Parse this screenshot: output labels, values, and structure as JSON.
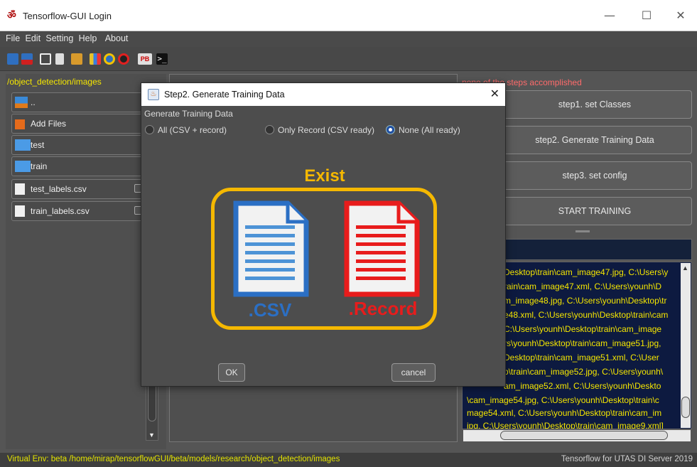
{
  "window": {
    "title": "Tensorflow-GUI Login",
    "minimize": "—",
    "maximize": "☐",
    "close": "✕"
  },
  "menu": [
    "File",
    "Edit",
    "Setting",
    "Help",
    "About"
  ],
  "toolbar": {
    "pb_label": "PB",
    "icons": [
      "new-icon",
      "open-icon",
      "check-icon",
      "delete-icon",
      "import-icon",
      "chart-icon",
      "zoom-icon",
      "zoom-stop-icon",
      "pb-icon",
      "terminal-icon"
    ]
  },
  "left": {
    "path": "/object_detection/images",
    "items": [
      {
        "label": ".."
      },
      {
        "label": "Add Files"
      },
      {
        "label": "test"
      },
      {
        "label": "train"
      },
      {
        "label": "test_labels.csv"
      },
      {
        "label": "train_labels.csv"
      }
    ]
  },
  "right": {
    "status_note": "none of the steps accomplished",
    "steps": [
      "step1. set Classes",
      "step2. Generate Training Data",
      "step3. set config",
      "START TRAINING"
    ],
    "log_lines": [
      "Desktop\\train\\cam_image47.jpg, C:\\Users\\y",
      "rain\\cam_image47.xml, C:\\Users\\younh\\D",
      "m_image48.jpg, C:\\Users\\younh\\Desktop\\tr",
      "e48.xml, C:\\Users\\younh\\Desktop\\train\\cam",
      "C:\\Users\\younh\\Desktop\\train\\cam_image",
      "rs\\younh\\Desktop\\train\\cam_image51.jpg,",
      "Desktop\\train\\cam_image51.xml, C:\\User",
      "p\\train\\cam_image52.jpg, C:\\Users\\younh\\",
      "am_image52.xml, C:\\Users\\younh\\Deskto",
      "\\cam_image54.jpg, C:\\Users\\younh\\Desktop\\train\\c",
      "mage54.xml, C:\\Users\\younh\\Desktop\\train\\cam_im",
      "jpg, C:\\Users\\younh\\Desktop\\train\\cam_image9.xml]"
    ]
  },
  "statusbar": {
    "left": "Virtual Env: beta /home/mirap/tensorflowGUI/beta/models/research/object_detection/images",
    "right": "Tensorflow for UTAS DI Server 2019"
  },
  "dialog": {
    "title": "Step2. Generate Training Data",
    "group_label": "Generate Training Data",
    "options": [
      {
        "label": "All (CSV + record)",
        "selected": false
      },
      {
        "label": "Only Record (CSV ready)",
        "selected": false
      },
      {
        "label": "None (All ready)",
        "selected": true
      }
    ],
    "illustration": {
      "heading": "Exist",
      "csv_label": ".CSV",
      "record_label": ".Record"
    },
    "ok": "OK",
    "cancel": "cancel"
  },
  "colors": {
    "accent_yellow": "#f5e600",
    "exist_gold": "#f5b800",
    "csv_blue": "#2b6fc4",
    "record_red": "#e81c1c",
    "status_red": "#ff6b6b"
  }
}
